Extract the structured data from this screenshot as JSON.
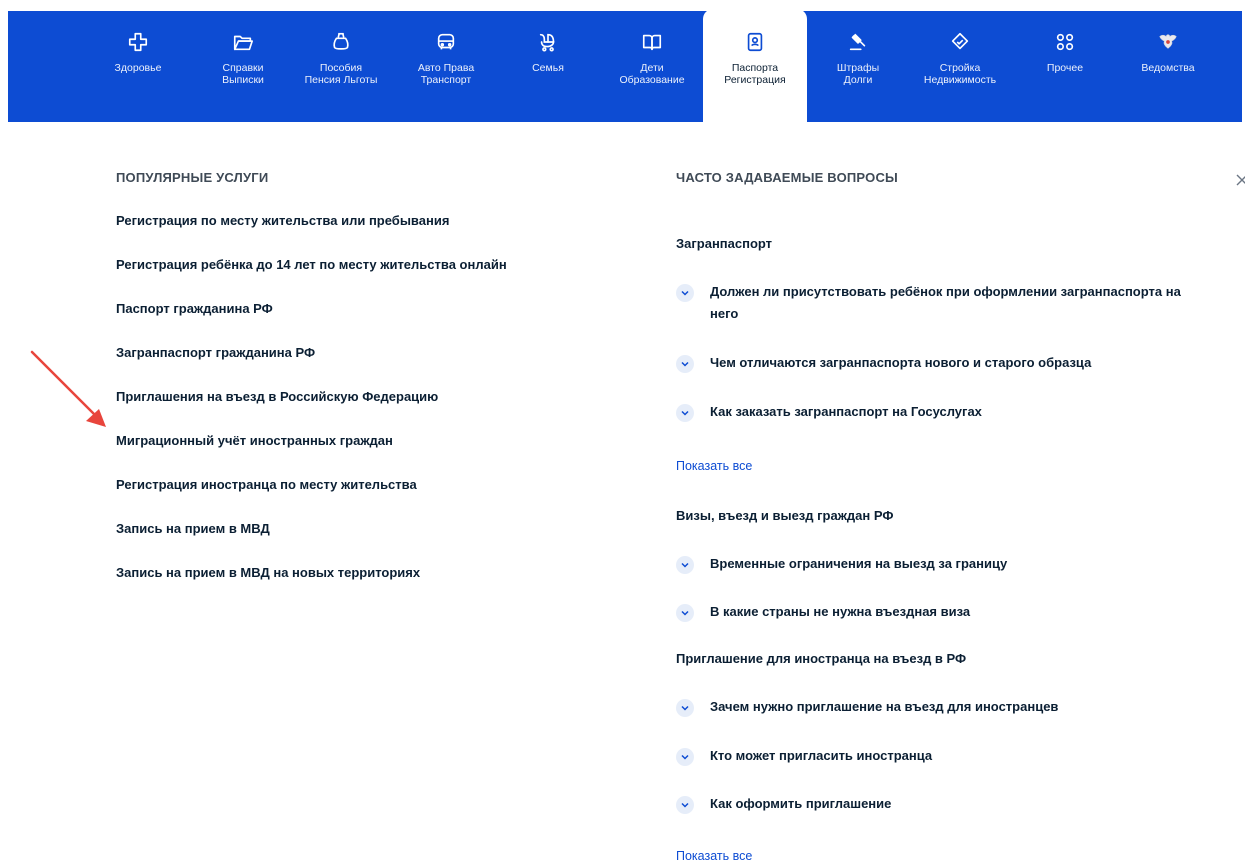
{
  "nav": {
    "items": [
      {
        "label": "Здоровье",
        "icon": "medical-cross-icon"
      },
      {
        "label": "Справки\nВыписки",
        "icon": "folder-icon"
      },
      {
        "label": "Пособия\nПенсия Льготы",
        "icon": "wallet-icon"
      },
      {
        "label": "Авто Права\nТранспорт",
        "icon": "car-icon"
      },
      {
        "label": "Семья",
        "icon": "stroller-icon"
      },
      {
        "label": "Дети\nОбразование",
        "icon": "book-icon"
      },
      {
        "label": "Паспорта\nРегистрация",
        "icon": "passport-icon",
        "active": true
      },
      {
        "label": "Штрафы\nДолги",
        "icon": "gavel-icon"
      },
      {
        "label": "Стройка\nНедвижимость",
        "icon": "house-icon"
      },
      {
        "label": "Прочее",
        "icon": "grid-icon"
      },
      {
        "label": "Ведомства",
        "icon": "coat-of-arms-icon"
      }
    ]
  },
  "popular": {
    "title": "ПОПУЛЯРНЫЕ УСЛУГИ",
    "items": [
      "Регистрация по месту жительства или пребывания",
      "Регистрация ребёнка до 14 лет по месту жительства онлайн",
      "Паспорт гражданина РФ",
      "Загранпаспорт гражданина РФ",
      "Приглашения на въезд в Российскую Федерацию",
      "Миграционный учёт иностранных граждан",
      "Регистрация иностранца по месту жительства",
      "Запись на прием в МВД",
      "Запись на прием в МВД на новых территориях"
    ]
  },
  "faq": {
    "title": "ЧАСТО ЗАДАВАЕМЫЕ ВОПРОСЫ",
    "show_all": "Показать все",
    "sections": [
      {
        "category": "Загранпаспорт",
        "questions": [
          "Должен ли присутствовать ребёнок при оформлении загранпаспорта на него",
          "Чем отличаются загранпаспорта нового и старого образца",
          "Как заказать загранпаспорт на Госуслугах"
        ]
      },
      {
        "category": "Визы, въезд и выезд граждан РФ",
        "questions": [
          "Временные ограничения на выезд за границу",
          "В какие страны не нужна въездная виза"
        ]
      },
      {
        "category": "Приглашение для иностранца на въезд в РФ",
        "questions": [
          "Зачем нужно приглашение на въезд для иностранцев",
          "Кто может пригласить иностранца",
          "Как оформить приглашение"
        ]
      }
    ]
  },
  "colors": {
    "nav_bg": "#0d4cd3",
    "link": "#0d4cd3",
    "arrow": "#e8453c"
  }
}
